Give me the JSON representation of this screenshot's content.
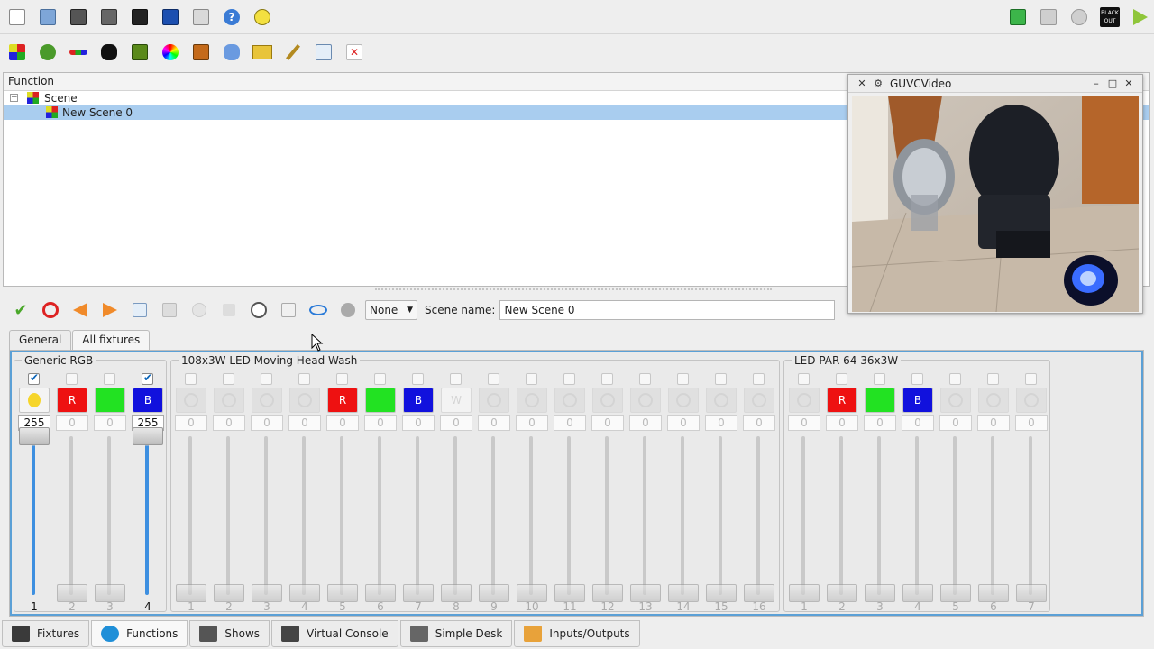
{
  "toolbar_top": {
    "icons": [
      "new-workspace-icon",
      "open-workspace-icon",
      "save-workspace-icon",
      "save-as-icon",
      "monitor-icon",
      "address-tool-icon",
      "fullscreen-icon",
      "help-icon",
      "about-icon"
    ],
    "right_icons": [
      "live-edit-icon",
      "dmx-dump-icon",
      "stop-all-icon",
      "blackout-icon",
      "operate-mode-icon"
    ],
    "blackout_label": "BLACK OUT"
  },
  "toolbar_functions": {
    "icons": [
      "new-scene-icon",
      "new-chaser-icon",
      "new-sequence-icon",
      "new-efx-icon",
      "new-collection-icon",
      "new-rgb-matrix-icon",
      "new-show-icon",
      "new-audio-icon",
      "new-video-icon",
      "wizard-icon",
      "clone-function-icon",
      "delete-function-icon"
    ]
  },
  "function_tree": {
    "header": "Function",
    "items": [
      {
        "label": "Scene",
        "level": 0,
        "expanded": true,
        "selected": false
      },
      {
        "label": "New Scene 0",
        "level": 1,
        "expanded": false,
        "selected": true
      }
    ]
  },
  "scene_editor": {
    "mode_select": "None",
    "scene_name_label": "Scene name:",
    "scene_name_value": "New Scene 0",
    "tabs": [
      {
        "label": "General",
        "active": false
      },
      {
        "label": "All fixtures",
        "active": true
      }
    ]
  },
  "fixture_groups": [
    {
      "title": "Generic RGB",
      "channels": [
        {
          "icon": "bulb",
          "label": "",
          "value": "255",
          "num": "1",
          "enabled": true,
          "checked": true
        },
        {
          "icon": "red",
          "label": "R",
          "value": "0",
          "num": "2",
          "enabled": false,
          "checked": false
        },
        {
          "icon": "green",
          "label": "",
          "value": "0",
          "num": "3",
          "enabled": false,
          "checked": false
        },
        {
          "icon": "blue",
          "label": "B",
          "value": "255",
          "num": "4",
          "enabled": true,
          "checked": true
        }
      ]
    },
    {
      "title": "108x3W LED Moving Head Wash",
      "channels": [
        {
          "icon": "pan-icon",
          "label": "",
          "value": "0",
          "num": "1"
        },
        {
          "icon": "tilt-icon",
          "label": "",
          "value": "0",
          "num": "2"
        },
        {
          "icon": "dimmer-icon",
          "label": "",
          "value": "0",
          "num": "3"
        },
        {
          "icon": "gobo-icon",
          "label": "",
          "value": "0",
          "num": "4"
        },
        {
          "icon": "red",
          "label": "R",
          "value": "0",
          "num": "5"
        },
        {
          "icon": "green",
          "label": "",
          "value": "0",
          "num": "6"
        },
        {
          "icon": "blue",
          "label": "B",
          "value": "0",
          "num": "7"
        },
        {
          "icon": "white",
          "label": "W",
          "value": "0",
          "num": "8"
        },
        {
          "icon": "speed-icon",
          "label": "",
          "value": "0",
          "num": "9"
        },
        {
          "icon": "shutter-icon",
          "label": "",
          "value": "0",
          "num": "10"
        },
        {
          "icon": "pan-icon",
          "label": "",
          "value": "0",
          "num": "11"
        },
        {
          "icon": "tilt-icon",
          "label": "",
          "value": "0",
          "num": "12"
        },
        {
          "icon": "maintenance-icon",
          "label": "",
          "value": "0",
          "num": "13"
        },
        {
          "icon": "maintenance-icon",
          "label": "",
          "value": "0",
          "num": "14"
        },
        {
          "icon": "speed-icon",
          "label": "",
          "value": "0",
          "num": "15"
        },
        {
          "icon": "gobo-icon",
          "label": "",
          "value": "0",
          "num": "16"
        }
      ]
    },
    {
      "title": "LED PAR 64 36x3W",
      "channels": [
        {
          "icon": "dimmer-icon",
          "label": "",
          "value": "0",
          "num": "1"
        },
        {
          "icon": "red",
          "label": "R",
          "value": "0",
          "num": "2"
        },
        {
          "icon": "green",
          "label": "",
          "value": "0",
          "num": "3"
        },
        {
          "icon": "blue",
          "label": "B",
          "value": "0",
          "num": "4"
        },
        {
          "icon": "gobo-icon",
          "label": "",
          "value": "0",
          "num": "5"
        },
        {
          "icon": "shutter-icon",
          "label": "",
          "value": "0",
          "num": "6"
        },
        {
          "icon": "speed-icon",
          "label": "",
          "value": "0",
          "num": "7"
        }
      ]
    }
  ],
  "bottom_tabs": [
    {
      "label": "Fixtures",
      "active": false,
      "color": "#3a3a3a"
    },
    {
      "label": "Functions",
      "active": true,
      "color": "#1f8fd8"
    },
    {
      "label": "Shows",
      "active": false,
      "color": "#555555"
    },
    {
      "label": "Virtual Console",
      "active": false,
      "color": "#444444"
    },
    {
      "label": "Simple Desk",
      "active": false,
      "color": "#666666"
    },
    {
      "label": "Inputs/Outputs",
      "active": false,
      "color": "#e8a23a"
    }
  ],
  "video_window": {
    "title": "GUVCVideo"
  },
  "colors": {
    "selection": "#a9cdef",
    "accent": "#3d8fe0",
    "red": "#ee1111",
    "green": "#22e222",
    "blue": "#1111dd"
  }
}
